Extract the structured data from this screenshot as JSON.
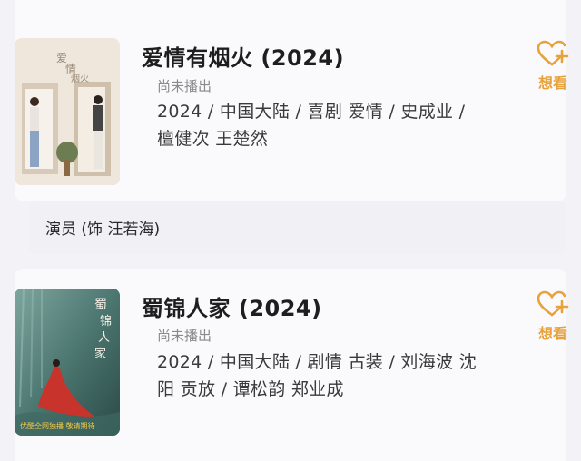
{
  "items": [
    {
      "title": "爱情有烟火 (2024)",
      "status": "尚未播出",
      "meta_line1": "2024 / 中国大陆 / 喜剧 爱情 / 史成业 /",
      "meta_line2": "檀健次 王楚然",
      "want_label": "想看",
      "poster_text": "爱情有烟火"
    },
    {
      "title": "蜀锦人家 (2024)",
      "status": "尚未播出",
      "meta_line1": "2024 / 中国大陆 / 剧情 古装 / 刘海波 沈",
      "meta_line2": "阳 贡放 / 谭松韵 郑业成",
      "want_label": "想看",
      "poster_text": "蜀锦人家",
      "poster_banner": "优酷全网独播 敬请期待"
    }
  ],
  "role": {
    "label": "演员 (饰 汪若海)"
  },
  "colors": {
    "accent": "#e8a23c",
    "card": "#fafafd",
    "page": "#f3f3f7"
  },
  "icons": {
    "want": "heart-plus-icon"
  }
}
